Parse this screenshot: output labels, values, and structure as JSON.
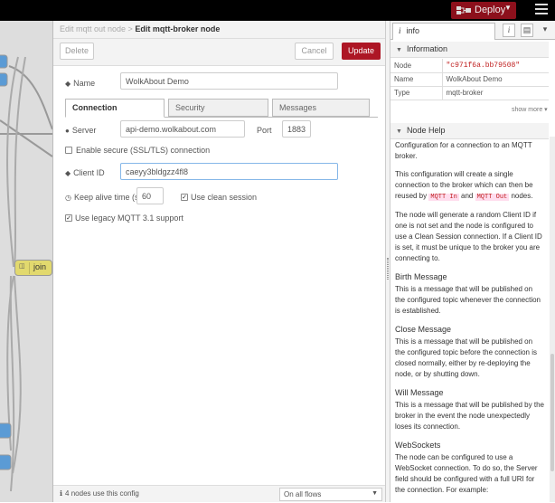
{
  "header": {
    "deploy_label": "Deploy",
    "deploy_color": "#8c101c"
  },
  "workspace": {
    "join_node_label": "join"
  },
  "tray": {
    "breadcrumb_parent": "Edit mqtt out node >",
    "breadcrumb_current": "Edit mqtt-broker node",
    "delete_label": "Delete",
    "cancel_label": "Cancel",
    "update_label": "Update",
    "accent_color": "#ad1625"
  },
  "form": {
    "name_label": "Name",
    "name_value": "WolkAbout Demo",
    "tabs": [
      {
        "label": "Connection",
        "active": true
      },
      {
        "label": "Security",
        "active": false
      },
      {
        "label": "Messages",
        "active": false
      }
    ],
    "server_label": "Server",
    "server_value": "api-demo.wolkabout.com",
    "port_label": "Port",
    "port_value": "1883",
    "tls_label": "Enable secure (SSL/TLS) connection",
    "tls_checked": false,
    "client_id_label": "Client ID",
    "client_id_value": "caeyy3bldgzz4fl8",
    "keepalive_label": "Keep alive time (s)",
    "keepalive_value": "60",
    "clean_session_label": "Use clean session",
    "clean_session_checked": true,
    "legacy_label": "Use legacy MQTT 3.1 support",
    "legacy_checked": true
  },
  "footer": {
    "usage_text": "4 nodes use this config",
    "scope_value": "On all flows"
  },
  "sidebar": {
    "tab_label": "info",
    "info_header": "Information",
    "info_rows": [
      {
        "key": "Node",
        "value": "\"c971f6a.bb79508\""
      },
      {
        "key": "Name",
        "value": "WolkAbout Demo"
      },
      {
        "key": "Type",
        "value": "mqtt-broker"
      }
    ],
    "show_more": "show more",
    "help_header": "Node Help",
    "help_p1": "Configuration for a connection to an MQTT broker.",
    "help_p2_a": "This configuration will create a single connection to the broker which can then be reused by",
    "help_p2_code1": "MQTT In",
    "help_p2_b": "and",
    "help_p2_code2": "MQTT Out",
    "help_p2_c": "nodes.",
    "help_p3": "The node will generate a random Client ID if one is not set and the node is configured to use a Clean Session connection. If a Client ID is set, it must be unique to the broker you are connecting to.",
    "birth_title": "Birth Message",
    "birth_text": "This is a message that will be published on the configured topic whenever the connection is established.",
    "close_title": "Close Message",
    "close_text": "This is a message that will be published on the configured topic before the connection is closed normally, either by re-deploying the node, or by shutting down.",
    "will_title": "Will Message",
    "will_text": "This is a message that will be published by the broker in the event the node unexpectedly loses its connection.",
    "ws_title": "WebSockets",
    "ws_text": "The node can be configured to use a WebSocket connection. To do so, the Server field should be configured with a full URI for the connection. For example:"
  }
}
